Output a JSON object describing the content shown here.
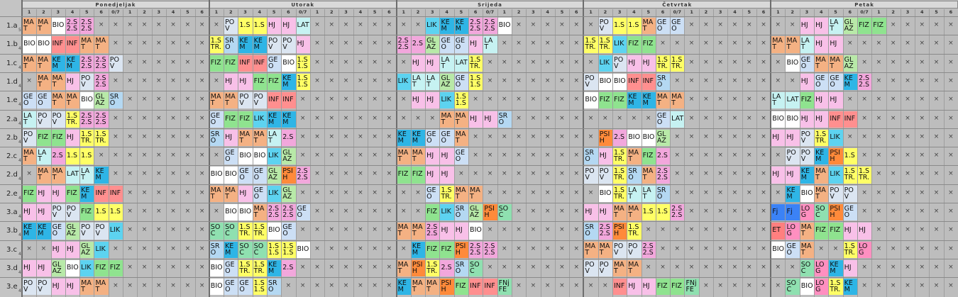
{
  "days": [
    "Ponedjeljak",
    "Utorak",
    "Srijeda",
    "Četvrtak",
    "Petak"
  ],
  "period_labels": [
    "1",
    "2",
    "3",
    "4",
    "5",
    "6",
    "0/7",
    "1",
    "2",
    "3",
    "4",
    "5",
    "6"
  ],
  "empty_mark": "×",
  "classes": [
    {
      "name": "1.a",
      "sub": "5",
      "cells": [
        [
          "MA|T",
          "MA|T",
          "BIO",
          "2.S|2.S",
          "2.S|2.S",
          "",
          "",
          "",
          "",
          "",
          "",
          "",
          ""
        ],
        [
          "",
          "PO|V",
          "1.S",
          "1.S",
          "HJ",
          "HJ",
          "LAT",
          "",
          "",
          "",
          "",
          "",
          ""
        ],
        [
          "",
          "",
          "LIK",
          "KE|M",
          "KE|M",
          "2.S|2.S",
          "2.S|2.S",
          "BIO",
          "",
          "",
          "",
          "",
          ""
        ],
        [
          "",
          "PO|V",
          "1.S",
          "1.S",
          "MA|T",
          "GE|O",
          "GE|O",
          "",
          "",
          "",
          "",
          "",
          ""
        ],
        [
          "",
          "",
          "HJ",
          "HJ",
          "LA|T",
          "GL|AZ",
          "FIZ",
          "FIZ",
          "",
          "",
          "",
          "",
          ""
        ]
      ]
    },
    {
      "name": "1.b",
      "sub": "4",
      "cells": [
        [
          "BIO",
          "BIO",
          "INF",
          "INF",
          "MA|T",
          "MA|T",
          "",
          "",
          "",
          "",
          "",
          "",
          ""
        ],
        [
          "1.S|TR.",
          "SR|O",
          "KE|M",
          "KE|M",
          "PO|V",
          "PO|V",
          "HJ",
          "",
          "",
          "",
          "",
          "",
          ""
        ],
        [
          "2.S|2.S",
          "2.S",
          "GL|AZ",
          "GE|O",
          "GE|O",
          "HJ",
          "LA|T",
          "",
          "",
          "",
          "",
          "",
          ""
        ],
        [
          "1.S|TR.",
          "1.S|TR.",
          "LIK",
          "FIZ",
          "FIZ",
          "",
          "",
          "",
          "",
          "",
          "",
          "",
          ""
        ],
        [
          "MA|T",
          "MA|T",
          "LA|T",
          "HJ",
          "HJ",
          "",
          "",
          "",
          "",
          "",
          "",
          "",
          ""
        ]
      ]
    },
    {
      "name": "1.c",
      "sub": "4",
      "cells": [
        [
          "MA|T",
          "MA|T",
          "KE|M",
          "KE|M",
          "2.S|2.S",
          "2.S|2.S",
          "PO|V",
          "",
          "",
          "",
          "",
          "",
          ""
        ],
        [
          "FIZ",
          "FIZ",
          "INF",
          "INF",
          "GE|O",
          "BIO",
          "1.S|1.S",
          "",
          "",
          "",
          "",
          "",
          ""
        ],
        [
          "",
          "HJ",
          "HJ",
          "LA|T",
          "LAT",
          "1.S|TR.",
          "",
          "",
          "",
          "",
          "",
          "",
          ""
        ],
        [
          "",
          "LIK",
          "PO|V",
          "HJ",
          "HJ",
          "1.S|TR.",
          "1.S|TR.",
          "",
          "",
          "",
          "",
          "",
          ""
        ],
        [
          "",
          "BIO",
          "GE|O",
          "MA|T",
          "MA|T",
          "GL|AZ",
          "",
          "",
          "",
          "",
          "",
          "",
          ""
        ]
      ]
    },
    {
      "name": "1.d",
      "sub": "4",
      "cells": [
        [
          "",
          "MA|T",
          "MA|T",
          "HJ",
          "PO|V",
          "2.S|2.S",
          "",
          "",
          "",
          "",
          "",
          "",
          ""
        ],
        [
          "",
          "HJ",
          "HJ",
          "FIZ",
          "FIZ",
          "KE|M",
          "1.S|1.S",
          "",
          "",
          "",
          "",
          "",
          ""
        ],
        [
          "LIK",
          "LA|T",
          "LA|T",
          "GL|AZ",
          "GE|O",
          "1.S|1.S",
          "",
          "",
          "",
          "",
          "",
          "",
          ""
        ],
        [
          "PO|V",
          "BIO",
          "BIO",
          "INF",
          "INF",
          "SR|O",
          "",
          "",
          "",
          "",
          "",
          "",
          ""
        ],
        [
          "",
          "",
          "HJ",
          "GE|O",
          "GE|O",
          "KE|M",
          "2.S|2.S",
          "",
          "",
          "",
          "",
          "",
          ""
        ]
      ]
    },
    {
      "name": "1.e",
      "sub": "4",
      "cells": [
        [
          "GE|O",
          "GE|O",
          "MA|T",
          "MA|T",
          "BIO",
          "GL|AZ",
          "SR|O",
          "",
          "",
          "",
          "",
          "",
          ""
        ],
        [
          "MA|T",
          "MA|T",
          "PO|V",
          "PO|V",
          "INF",
          "INF",
          "",
          "",
          "",
          "",
          "",
          "",
          ""
        ],
        [
          "",
          "HJ",
          "HJ",
          "LIK",
          "1.S|1.S",
          "",
          "",
          "",
          "",
          "",
          "",
          "",
          ""
        ],
        [
          "BIO",
          "FIZ",
          "FIZ",
          "KE|M",
          "KE|M",
          "MA|T",
          "MA|T",
          "",
          "",
          "",
          "",
          "",
          ""
        ],
        [
          "LA|T",
          "LAT",
          "FIZ",
          "HJ",
          "HJ",
          "",
          "",
          "",
          "",
          "",
          "",
          "",
          ""
        ]
      ]
    },
    {
      "name": "2.a",
      "sub": "4",
      "cells": [
        [
          "LA|T",
          "PO|V",
          "PO|V",
          "1.S|TR.",
          "2.S|2.S",
          "2.S|2.S",
          "",
          "",
          "",
          "",
          "",
          "",
          ""
        ],
        [
          "GE|O",
          "FIZ",
          "FIZ",
          "LIK",
          "KE|M",
          "KE|M",
          "",
          "",
          "",
          "",
          "",
          "",
          ""
        ],
        [
          "",
          "",
          "",
          "MA|T",
          "MA|T",
          "HJ",
          "HJ",
          "SR|O",
          "",
          "",
          "",
          "",
          ""
        ],
        [
          "",
          "",
          "",
          "",
          "",
          "GE|O",
          "LAT",
          "",
          "",
          "",
          "",
          "",
          ""
        ],
        [
          "BIO",
          "BIO",
          "HJ",
          "HJ",
          "INF",
          "INF",
          "",
          "",
          "",
          "",
          "",
          "",
          ""
        ]
      ]
    },
    {
      "name": "2.b",
      "sub": "4",
      "cells": [
        [
          "PO|V",
          "FIZ",
          "FIZ",
          "HJ",
          "1.S|TR.",
          "1.S|TR.",
          "",
          "",
          "",
          "",
          "",
          "",
          ""
        ],
        [
          "SR|O",
          "HJ",
          "MA|T",
          "MA|T",
          "LA|T",
          "2.S",
          "",
          "",
          "",
          "",
          "",
          "",
          ""
        ],
        [
          "KE|M",
          "KE|M",
          "GE|O",
          "GE|O",
          "MA|T",
          "",
          "",
          "",
          "",
          "",
          "",
          "",
          ""
        ],
        [
          "",
          "PSI|H",
          "2.S",
          "BIO",
          "BIO",
          "GL|AZ",
          "",
          "",
          "",
          "",
          "",
          "",
          ""
        ],
        [
          "HJ",
          "HJ",
          "PO|V",
          "1.S|TR.",
          "LIK",
          "",
          "",
          "",
          "",
          "",
          "",
          "",
          ""
        ]
      ]
    },
    {
      "name": "2.c",
      "sub": "4",
      "cells": [
        [
          "MA|T",
          "LA|T",
          "2.S",
          "1.S",
          "1.S",
          "",
          "",
          "",
          "",
          "",
          "",
          "",
          ""
        ],
        [
          "",
          "GE|O",
          "BIO",
          "BIO",
          "LIK",
          "GL|AZ",
          "",
          "",
          "",
          "",
          "",
          "",
          ""
        ],
        [
          "MA|T",
          "MA|T",
          "HJ",
          "HJ",
          "GE|O",
          "",
          "",
          "",
          "",
          "",
          "",
          "",
          ""
        ],
        [
          "SR|O",
          "HJ",
          "1.S|TR.",
          "MA|T",
          "FIZ",
          "2.S",
          "",
          "",
          "",
          "",
          "",
          "",
          ""
        ],
        [
          "",
          "PO|V",
          "PO|V",
          "KE|M",
          "PSI|H",
          "1.S",
          "",
          "",
          "",
          "",
          "",
          "",
          ""
        ]
      ]
    },
    {
      "name": "2.d",
      "sub": "4",
      "cells": [
        [
          "",
          "MA|T",
          "MA|T",
          "LAT",
          "LA|T",
          "KE|M",
          "",
          "",
          "",
          "",
          "",
          "",
          ""
        ],
        [
          "BIO",
          "BIO",
          "GE|O",
          "GE|O",
          "GL|AZ",
          "PSI|H",
          "2.S|2.S",
          "",
          "",
          "",
          "",
          "",
          ""
        ],
        [
          "FIZ",
          "FIZ",
          "HJ",
          "HJ",
          "",
          "",
          "",
          "",
          "",
          "",
          "",
          "",
          ""
        ],
        [
          "PO|V",
          "PO|V",
          "1.S|TR.",
          "SR|O",
          "MA|T",
          "2.S|2.S",
          "",
          "",
          "",
          "",
          "",
          "",
          ""
        ],
        [
          "HJ",
          "HJ",
          "KE|M",
          "MA|T",
          "LIK",
          "1.S|TR.",
          "1.S|TR.",
          "",
          "",
          "",
          "",
          "",
          ""
        ]
      ]
    },
    {
      "name": "2.e",
      "sub": "4",
      "cells": [
        [
          "FIZ",
          "HJ",
          "HJ",
          "FIZ",
          "KE|M",
          "INF",
          "INF",
          "",
          "",
          "",
          "",
          "",
          ""
        ],
        [
          "MA|T",
          "MA|T",
          "HJ",
          "GE|O",
          "LIK",
          "GL|AZ",
          "",
          "",
          "",
          "",
          "",
          "",
          ""
        ],
        [
          "",
          "",
          "GE|O",
          "1.S|TR.",
          "MA|T",
          "MA|T",
          "",
          "",
          "",
          "",
          "",
          "",
          ""
        ],
        [
          "",
          "BIO",
          "1.S|TR.",
          "LA|T",
          "LA|T",
          "SR|O",
          "",
          "",
          "",
          "",
          "",
          "",
          ""
        ],
        [
          "",
          "KE|M",
          "BIO",
          "MA|T",
          "PO|V",
          "PO|V",
          "",
          "",
          "",
          "",
          "",
          "",
          ""
        ]
      ]
    },
    {
      "name": "3.a",
      "sub": "4",
      "cells": [
        [
          "HJ",
          "HJ",
          "PO|V",
          "PO|V",
          "FIZ",
          "1.S",
          "1.S",
          "",
          "",
          "",
          "",
          "",
          ""
        ],
        [
          "",
          "BIO",
          "BIO",
          "MA|T",
          "2.S|2.S",
          "2.S|2.S",
          "GE|O",
          "",
          "",
          "",
          "",
          "",
          ""
        ],
        [
          "",
          "",
          "FIZ",
          "LIK",
          "SR|O",
          "GL|AZ",
          "PSI|H",
          "SO|C",
          "",
          "",
          "",
          "",
          ""
        ],
        [
          "HJ",
          "HJ",
          "MA|T",
          "MA|T",
          "1.S",
          "1.S",
          "2.S|2.S",
          "",
          "",
          "",
          "",
          "",
          ""
        ],
        [
          "Fj",
          "Fj",
          "LO|G",
          "SO|C",
          "PSI|H",
          "GE|O",
          "",
          "",
          "",
          "",
          "",
          "",
          ""
        ]
      ]
    },
    {
      "name": "3.b",
      "sub": "4",
      "cells": [
        [
          "KE|M",
          "KE|M",
          "GE|O",
          "GL|AZ",
          "PO|V",
          "PO|V",
          "LIK",
          "",
          "",
          "",
          "",
          "",
          ""
        ],
        [
          "SO|C",
          "SO|C",
          "1.S|TR.",
          "1.S|TR.",
          "BIO",
          "GE|O",
          "",
          "",
          "",
          "",
          "",
          "",
          ""
        ],
        [
          "MA|T",
          "MA|T",
          "2.S|2.S",
          "HJ",
          "HJ",
          "BIO",
          "",
          "",
          "",
          "",
          "",
          "",
          ""
        ],
        [
          "SR|O",
          "2.S|2.S",
          "PSI|H",
          "1.S|TR.",
          "",
          "",
          "",
          "",
          "",
          "",
          "",
          "",
          ""
        ],
        [
          "ET",
          "LO|G",
          "MA|T",
          "FIZ",
          "FIZ",
          "HJ",
          "HJ",
          "",
          "",
          "",
          "",
          "",
          ""
        ]
      ]
    },
    {
      "name": "3.c",
      "sub": "4",
      "cells": [
        [
          "",
          "",
          "HJ",
          "HJ",
          "GL|AZ",
          "LIK",
          "",
          "",
          "",
          "",
          "",
          "",
          ""
        ],
        [
          "SR|O",
          "KE|M",
          "SO|C",
          "SO|C",
          "1.S|1.S",
          "1.S|1.S",
          "BIO",
          "",
          "",
          "",
          "",
          "",
          ""
        ],
        [
          "",
          "KE|M",
          "FIZ",
          "FIZ",
          "PSI|H",
          "2.S|2.S",
          "2.S|2.S",
          "",
          "",
          "",
          "",
          "",
          ""
        ],
        [
          "MA|T",
          "MA|T",
          "PO|V",
          "PO|V",
          "2.S|2.S",
          "",
          "",
          "",
          "",
          "",
          "",
          "",
          ""
        ],
        [
          "BIO",
          "GE|O",
          "MA|T",
          "",
          "",
          "1.S|TR.",
          "LO|G",
          "",
          "",
          "",
          "",
          "",
          ""
        ]
      ]
    },
    {
      "name": "3.d",
      "sub": "4",
      "cells": [
        [
          "HJ",
          "HJ",
          "GL|AZ",
          "BIO",
          "LIK",
          "FIZ",
          "FIZ",
          "",
          "",
          "",
          "",
          "",
          ""
        ],
        [
          "BIO",
          "GE|O",
          "1.S|TR.",
          "1.S|TR.",
          "KE|M",
          "2.S",
          "",
          "",
          "",
          "",
          "",
          "",
          ""
        ],
        [
          "MA|T",
          "PSI|H",
          "1.S|TR.",
          "2.S",
          "SR|O",
          "SO|C",
          "",
          "",
          "",
          "",
          "",
          "",
          ""
        ],
        [
          "PO|V",
          "PO|V",
          "MA|T",
          "MA|T",
          "",
          "",
          "",
          "",
          "",
          "",
          "",
          "",
          ""
        ],
        [
          "",
          "",
          "SO|C",
          "LO|G",
          "KE|M",
          "HJ",
          "",
          "",
          "",
          "",
          "",
          "",
          ""
        ]
      ]
    },
    {
      "name": "3.e",
      "sub": "4",
      "cells": [
        [
          "PO|V",
          "PO|V",
          "HJ",
          "HJ",
          "MA|T",
          "MA|T",
          "",
          "",
          "",
          "",
          "",
          "",
          ""
        ],
        [
          "BIO",
          "GE|O",
          "GE|O",
          "1.S|1.S",
          "SR|O",
          "",
          "",
          "",
          "",
          "",
          "",
          "",
          ""
        ],
        [
          "KE|M",
          "MA|T",
          "MA|T",
          "PSI|H",
          "FIZ",
          "INF",
          "INF",
          "FNj|FE",
          "",
          "",
          "",
          "",
          ""
        ],
        [
          "",
          "",
          "INF",
          "HJ",
          "HJ",
          "FIZ",
          "FIZ",
          "FNj|FE",
          "",
          "",
          "",
          "",
          ""
        ],
        [
          "",
          "SO|C",
          "BIO",
          "LO|G",
          "1.S|TR.",
          "KE|M",
          "",
          "",
          "",
          "",
          "",
          "",
          ""
        ]
      ]
    }
  ],
  "colors": {
    "MA": "#f4b183",
    "BIO": "#ffffff",
    "2.S": "#f2a7dc",
    "1.S": "#ffff66",
    "PO": "#dbe5f1",
    "HJ": "#f8c0e8",
    "LAT": "#c6f2f2",
    "LA": "#c6f2f2",
    "LIK": "#5dd3f0",
    "KE": "#2eb5e6",
    "GE": "#ccdff5",
    "GL": "#b8e9a8",
    "FIZ": "#8fe38f",
    "INF": "#ff8f8f",
    "SR": "#b4d8f2",
    "PSI": "#ff8a3a",
    "SO": "#8fe0b0",
    "LO": "#ff8fc0",
    "Fj": "#3b82f6",
    "ET": "#ff7f7f",
    "FNj": "#8fe0b0"
  }
}
